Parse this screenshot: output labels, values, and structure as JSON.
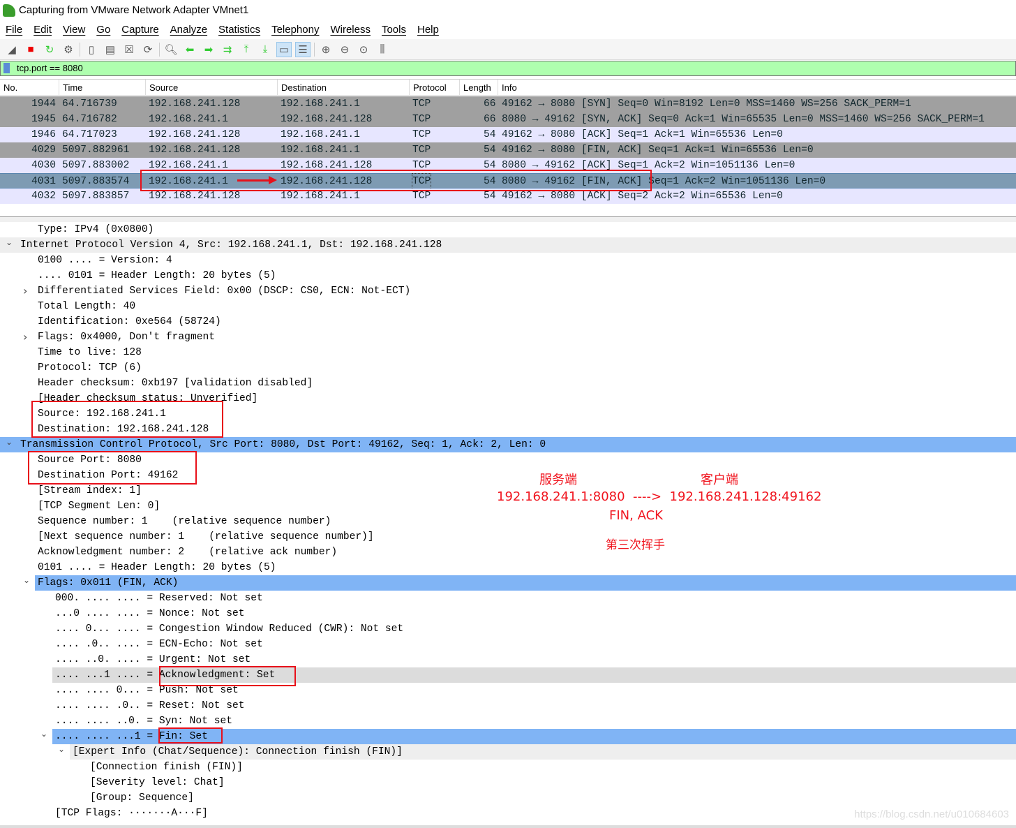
{
  "window": {
    "title": "Capturing from VMware Network Adapter VMnet1"
  },
  "menu": [
    "File",
    "Edit",
    "View",
    "Go",
    "Capture",
    "Analyze",
    "Statistics",
    "Telephony",
    "Wireless",
    "Tools",
    "Help"
  ],
  "toolbar": [
    {
      "icon": "shark-fin-icon"
    },
    {
      "icon": "stop-icon"
    },
    {
      "icon": "restart-icon"
    },
    {
      "icon": "options-gear-icon"
    },
    {
      "icon": "open-file-icon"
    },
    {
      "icon": "save-icon"
    },
    {
      "icon": "close-file-icon"
    },
    {
      "icon": "reload-icon"
    },
    {
      "icon": "find-icon"
    },
    {
      "icon": "back-arrow-icon"
    },
    {
      "icon": "forward-arrow-icon"
    },
    {
      "icon": "go-to-packet-icon"
    },
    {
      "icon": "first-packet-icon"
    },
    {
      "icon": "last-packet-icon"
    },
    {
      "icon": "autoscroll-icon"
    },
    {
      "icon": "colorize-icon"
    },
    {
      "icon": "zoom-in-icon"
    },
    {
      "icon": "zoom-out-icon"
    },
    {
      "icon": "zoom-reset-icon"
    },
    {
      "icon": "resize-columns-icon"
    }
  ],
  "filter": {
    "value": "tcp.port == 8080"
  },
  "packet_list": {
    "columns": [
      "No.",
      "Time",
      "Source",
      "Destination",
      "Protocol",
      "Length",
      "Info"
    ],
    "rows": [
      {
        "no": "1944",
        "time": "64.716739",
        "src": "192.168.241.128",
        "dst": "192.168.241.1",
        "proto": "TCP",
        "len": "66",
        "info": "49162 → 8080 [SYN] Seq=0 Win=8192 Len=0 MSS=1460 WS=256 SACK_PERM=1",
        "bg": "#a0a0a0"
      },
      {
        "no": "1945",
        "time": "64.716782",
        "src": "192.168.241.1",
        "dst": "192.168.241.128",
        "proto": "TCP",
        "len": "66",
        "info": "8080 → 49162 [SYN, ACK] Seq=0 Ack=1 Win=65535 Len=0 MSS=1460 WS=256 SACK_PERM=1",
        "bg": "#a0a0a0"
      },
      {
        "no": "1946",
        "time": "64.717023",
        "src": "192.168.241.128",
        "dst": "192.168.241.1",
        "proto": "TCP",
        "len": "54",
        "info": "49162 → 8080 [ACK] Seq=1 Ack=1 Win=65536 Len=0",
        "bg": "#e7e6ff"
      },
      {
        "no": "4029",
        "time": "5097.882961",
        "src": "192.168.241.128",
        "dst": "192.168.241.1",
        "proto": "TCP",
        "len": "54",
        "info": "49162 → 8080 [FIN, ACK] Seq=1 Ack=1 Win=65536 Len=0",
        "bg": "#a0a0a0"
      },
      {
        "no": "4030",
        "time": "5097.883002",
        "src": "192.168.241.1",
        "dst": "192.168.241.128",
        "proto": "TCP",
        "len": "54",
        "info": "8080 → 49162 [ACK] Seq=1 Ack=2 Win=1051136 Len=0",
        "bg": "#e7e6ff"
      },
      {
        "no": "4031",
        "time": "5097.883574",
        "src": "192.168.241.1",
        "dst": "192.168.241.128",
        "proto": "TCP",
        "len": "54",
        "info": "8080 → 49162 [FIN, ACK] Seq=1 Ack=2 Win=1051136 Len=0",
        "bg": "#7e9bb3",
        "selected": true
      },
      {
        "no": "4032",
        "time": "5097.883857",
        "src": "192.168.241.128",
        "dst": "192.168.241.1",
        "proto": "TCP",
        "len": "54",
        "info": "49162 → 8080 [ACK] Seq=2 Ack=2 Win=65536 Len=0",
        "bg": "#e7e6ff"
      }
    ]
  },
  "details": [
    {
      "text": "Type: IPv4 (0x0800)",
      "level": 1,
      "exp": "",
      "hl": ""
    },
    {
      "text": "Internet Protocol Version 4, Src: 192.168.241.1, Dst: 192.168.241.128",
      "level": 0,
      "exp": "open",
      "hl": "gray"
    },
    {
      "text": "0100 .... = Version: 4",
      "level": 1,
      "exp": "",
      "hl": ""
    },
    {
      "text": ".... 0101 = Header Length: 20 bytes (5)",
      "level": 1,
      "exp": "",
      "hl": ""
    },
    {
      "text": "Differentiated Services Field: 0x00 (DSCP: CS0, ECN: Not-ECT)",
      "level": 1,
      "exp": "closed",
      "hl": ""
    },
    {
      "text": "Total Length: 40",
      "level": 1,
      "exp": "",
      "hl": ""
    },
    {
      "text": "Identification: 0xe564 (58724)",
      "level": 1,
      "exp": "",
      "hl": ""
    },
    {
      "text": "Flags: 0x4000, Don't fragment",
      "level": 1,
      "exp": "closed",
      "hl": ""
    },
    {
      "text": "Time to live: 128",
      "level": 1,
      "exp": "",
      "hl": ""
    },
    {
      "text": "Protocol: TCP (6)",
      "level": 1,
      "exp": "",
      "hl": ""
    },
    {
      "text": "Header checksum: 0xb197 [validation disabled]",
      "level": 1,
      "exp": "",
      "hl": ""
    },
    {
      "text": "[Header checksum status: Unverified]",
      "level": 1,
      "exp": "",
      "hl": ""
    },
    {
      "text": "Source: 192.168.241.1",
      "level": 1,
      "exp": "",
      "hl": ""
    },
    {
      "text": "Destination: 192.168.241.128",
      "level": 1,
      "exp": "",
      "hl": ""
    },
    {
      "text": "Transmission Control Protocol, Src Port: 8080, Dst Port: 49162, Seq: 1, Ack: 2, Len: 0",
      "level": 0,
      "exp": "open",
      "hl": "blue"
    },
    {
      "text": "Source Port: 8080",
      "level": 1,
      "exp": "",
      "hl": ""
    },
    {
      "text": "Destination Port: 49162",
      "level": 1,
      "exp": "",
      "hl": ""
    },
    {
      "text": "[Stream index: 1]",
      "level": 1,
      "exp": "",
      "hl": ""
    },
    {
      "text": "[TCP Segment Len: 0]",
      "level": 1,
      "exp": "",
      "hl": ""
    },
    {
      "text": "Sequence number: 1    (relative sequence number)",
      "level": 1,
      "exp": "",
      "hl": ""
    },
    {
      "text": "[Next sequence number: 1    (relative sequence number)]",
      "level": 1,
      "exp": "",
      "hl": ""
    },
    {
      "text": "Acknowledgment number: 2    (relative ack number)",
      "level": 1,
      "exp": "",
      "hl": ""
    },
    {
      "text": "0101 .... = Header Length: 20 bytes (5)",
      "level": 1,
      "exp": "",
      "hl": ""
    },
    {
      "text": "Flags: 0x011 (FIN, ACK)",
      "level": 1,
      "exp": "open",
      "hl": "blue"
    },
    {
      "text": "000. .... .... = Reserved: Not set",
      "level": 2,
      "exp": "",
      "hl": ""
    },
    {
      "text": "...0 .... .... = Nonce: Not set",
      "level": 2,
      "exp": "",
      "hl": ""
    },
    {
      "text": ".... 0... .... = Congestion Window Reduced (CWR): Not set",
      "level": 2,
      "exp": "",
      "hl": ""
    },
    {
      "text": ".... .0.. .... = ECN-Echo: Not set",
      "level": 2,
      "exp": "",
      "hl": ""
    },
    {
      "text": ".... ..0. .... = Urgent: Not set",
      "level": 2,
      "exp": "",
      "hl": ""
    },
    {
      "text": ".... ...1 .... = Acknowledgment: Set",
      "level": 2,
      "exp": "",
      "hl": "gray2"
    },
    {
      "text": ".... .... 0... = Push: Not set",
      "level": 2,
      "exp": "",
      "hl": ""
    },
    {
      "text": ".... .... .0.. = Reset: Not set",
      "level": 2,
      "exp": "",
      "hl": ""
    },
    {
      "text": ".... .... ..0. = Syn: Not set",
      "level": 2,
      "exp": "",
      "hl": ""
    },
    {
      "text": ".... .... ...1 = Fin: Set",
      "level": 2,
      "exp": "open",
      "hl": "blue"
    },
    {
      "text": "[Expert Info (Chat/Sequence): Connection finish (FIN)]",
      "level": 3,
      "exp": "open",
      "hl": "gray"
    },
    {
      "text": "[Connection finish (FIN)]",
      "level": 4,
      "exp": "",
      "hl": ""
    },
    {
      "text": "[Severity level: Chat]",
      "level": 4,
      "exp": "",
      "hl": ""
    },
    {
      "text": "[Group: Sequence]",
      "level": 4,
      "exp": "",
      "hl": ""
    },
    {
      "text": "[TCP Flags: ·······A···F]",
      "level": 2,
      "exp": "",
      "hl": ""
    }
  ],
  "annotations": {
    "server": "服务端",
    "client": "客户端",
    "flow": "192.168.241.1:8080  ---->  192.168.241.128:49162",
    "flags": "FIN, ACK",
    "caption": "第三次挥手"
  },
  "watermark": "https://blog.csdn.net/u010684603",
  "colors": {
    "accent_red": "#e8101a",
    "selected_row": "#7e9bb3",
    "highlight_blue": "#80b4f5",
    "filter_ok": "#afffaf"
  }
}
